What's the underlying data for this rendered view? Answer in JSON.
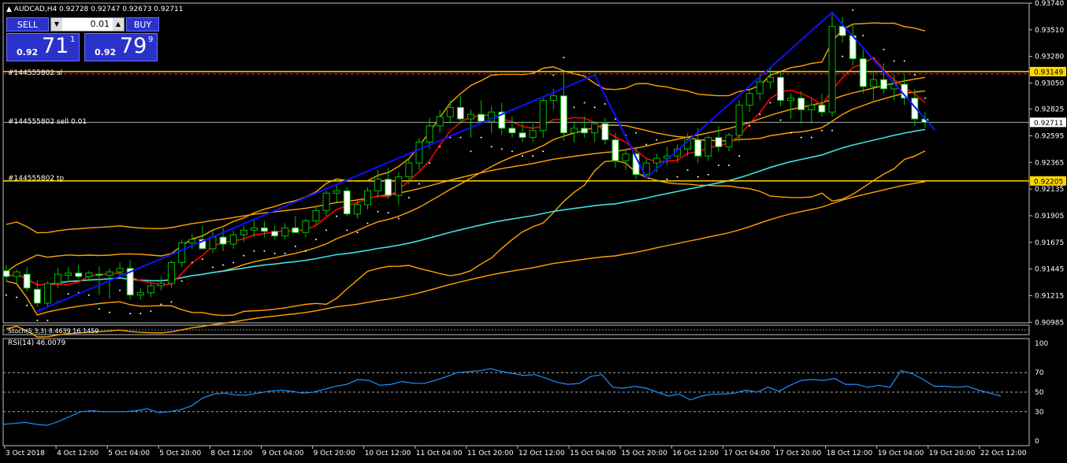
{
  "header": {
    "symbol_line": "AUDCAD,H4  0.92728 0.92747 0.92673 0.92711"
  },
  "one_click": {
    "sell_label": "SELL",
    "buy_label": "BUY",
    "lot": "0.01",
    "sell_small": "0.92",
    "sell_big": "71",
    "sell_sup": "1",
    "buy_small": "0.92",
    "buy_big": "79",
    "buy_sup": "9"
  },
  "order_lines": {
    "sl_label": "#144555802 sl",
    "sell_label": "#144555802 sell 0.01",
    "tp_label": "#144555802 tp"
  },
  "stoch_label": "Stoch(5,3,3) 8.4639 16.1459",
  "rsi_label": "RSI(14) 46.0079",
  "colors": {
    "bg": "#000000",
    "bull": "#00c000",
    "bear_body": "#ffffff",
    "ma_red": "#ff0000",
    "ma_cyan": "#40e0e0",
    "bands": "#ffa500",
    "zigzag": "#1010ff",
    "order_line": "#ffd700",
    "rsi_line": "#1e90ff"
  },
  "chart_data": {
    "type": "candlestick",
    "ylim": [
      0.9098,
      0.9374
    ],
    "y_ticks": [
      "0.93740",
      "0.93510",
      "0.93280",
      "0.93050",
      "0.92825",
      "0.92595",
      "0.92365",
      "0.92135",
      "0.91905",
      "0.91675",
      "0.91445",
      "0.91215",
      "0.90985"
    ],
    "x_ticks": [
      "3 Oct 2018",
      "4 Oct 12:00",
      "5 Oct 04:00",
      "5 Oct 20:00",
      "8 Oct 12:00",
      "9 Oct 04:00",
      "9 Oct 20:00",
      "10 Oct 12:00",
      "11 Oct 04:00",
      "11 Oct 20:00",
      "12 Oct 12:00",
      "15 Oct 04:00",
      "15 Oct 20:00",
      "16 Oct 12:00",
      "17 Oct 04:00",
      "17 Oct 20:00",
      "18 Oct 12:00",
      "19 Oct 04:00",
      "19 Oct 20:00",
      "22 Oct 12:00"
    ],
    "price_labels": {
      "sl": "0.93149",
      "current": "0.92711",
      "tp": "0.92205"
    },
    "levels": {
      "sl": 0.93149,
      "current": 0.92711,
      "tp": 0.92205
    },
    "candles": [
      {
        "o": 0.9143,
        "h": 0.9148,
        "l": 0.9134,
        "c": 0.9138
      },
      {
        "o": 0.9138,
        "h": 0.9144,
        "l": 0.9132,
        "c": 0.9142
      },
      {
        "o": 0.914,
        "h": 0.9146,
        "l": 0.9125,
        "c": 0.9128
      },
      {
        "o": 0.9127,
        "h": 0.9135,
        "l": 0.9112,
        "c": 0.9115
      },
      {
        "o": 0.9115,
        "h": 0.9134,
        "l": 0.9112,
        "c": 0.9132
      },
      {
        "o": 0.9132,
        "h": 0.9145,
        "l": 0.9128,
        "c": 0.914
      },
      {
        "o": 0.9139,
        "h": 0.9146,
        "l": 0.9135,
        "c": 0.9141
      },
      {
        "o": 0.9141,
        "h": 0.9148,
        "l": 0.9136,
        "c": 0.9138
      },
      {
        "o": 0.9138,
        "h": 0.9143,
        "l": 0.9134,
        "c": 0.9141
      },
      {
        "o": 0.914,
        "h": 0.9147,
        "l": 0.9122,
        "c": 0.9139
      },
      {
        "o": 0.9139,
        "h": 0.9145,
        "l": 0.9119,
        "c": 0.9142
      },
      {
        "o": 0.9142,
        "h": 0.915,
        "l": 0.9138,
        "c": 0.9145
      },
      {
        "o": 0.9145,
        "h": 0.9152,
        "l": 0.9118,
        "c": 0.9122
      },
      {
        "o": 0.9122,
        "h": 0.9128,
        "l": 0.9118,
        "c": 0.9124
      },
      {
        "o": 0.9124,
        "h": 0.9132,
        "l": 0.912,
        "c": 0.913
      },
      {
        "o": 0.913,
        "h": 0.9138,
        "l": 0.9126,
        "c": 0.9132
      },
      {
        "o": 0.9132,
        "h": 0.9152,
        "l": 0.9128,
        "c": 0.915
      },
      {
        "o": 0.915,
        "h": 0.917,
        "l": 0.9146,
        "c": 0.9167
      },
      {
        "o": 0.9167,
        "h": 0.9175,
        "l": 0.9162,
        "c": 0.917
      },
      {
        "o": 0.917,
        "h": 0.9182,
        "l": 0.9165,
        "c": 0.9162
      },
      {
        "o": 0.9162,
        "h": 0.9178,
        "l": 0.9158,
        "c": 0.9172
      },
      {
        "o": 0.9172,
        "h": 0.918,
        "l": 0.916,
        "c": 0.9166
      },
      {
        "o": 0.9166,
        "h": 0.9178,
        "l": 0.9162,
        "c": 0.9174
      },
      {
        "o": 0.9174,
        "h": 0.9182,
        "l": 0.9168,
        "c": 0.9178
      },
      {
        "o": 0.9178,
        "h": 0.9188,
        "l": 0.9172,
        "c": 0.918
      },
      {
        "o": 0.918,
        "h": 0.9186,
        "l": 0.9172,
        "c": 0.9177
      },
      {
        "o": 0.9177,
        "h": 0.9182,
        "l": 0.917,
        "c": 0.9173
      },
      {
        "o": 0.9173,
        "h": 0.9184,
        "l": 0.917,
        "c": 0.918
      },
      {
        "o": 0.918,
        "h": 0.919,
        "l": 0.9176,
        "c": 0.9176
      },
      {
        "o": 0.9176,
        "h": 0.9188,
        "l": 0.9172,
        "c": 0.9186
      },
      {
        "o": 0.9186,
        "h": 0.9198,
        "l": 0.9182,
        "c": 0.9195
      },
      {
        "o": 0.9195,
        "h": 0.9212,
        "l": 0.919,
        "c": 0.921
      },
      {
        "o": 0.921,
        "h": 0.9218,
        "l": 0.9202,
        "c": 0.9212
      },
      {
        "o": 0.9212,
        "h": 0.9215,
        "l": 0.919,
        "c": 0.9192
      },
      {
        "o": 0.9192,
        "h": 0.9205,
        "l": 0.9188,
        "c": 0.92
      },
      {
        "o": 0.92,
        "h": 0.9215,
        "l": 0.9196,
        "c": 0.9212
      },
      {
        "o": 0.9212,
        "h": 0.923,
        "l": 0.9206,
        "c": 0.9222
      },
      {
        "o": 0.9222,
        "h": 0.9232,
        "l": 0.9205,
        "c": 0.9208
      },
      {
        "o": 0.9208,
        "h": 0.9228,
        "l": 0.92,
        "c": 0.9224
      },
      {
        "o": 0.9224,
        "h": 0.924,
        "l": 0.9218,
        "c": 0.9236
      },
      {
        "o": 0.9236,
        "h": 0.9258,
        "l": 0.923,
        "c": 0.9254
      },
      {
        "o": 0.9254,
        "h": 0.9275,
        "l": 0.9248,
        "c": 0.9268
      },
      {
        "o": 0.9268,
        "h": 0.9282,
        "l": 0.9262,
        "c": 0.9276
      },
      {
        "o": 0.9276,
        "h": 0.929,
        "l": 0.927,
        "c": 0.9284
      },
      {
        "o": 0.9284,
        "h": 0.9294,
        "l": 0.927,
        "c": 0.9274
      },
      {
        "o": 0.9274,
        "h": 0.9282,
        "l": 0.9258,
        "c": 0.9278
      },
      {
        "o": 0.9278,
        "h": 0.929,
        "l": 0.927,
        "c": 0.9272
      },
      {
        "o": 0.9272,
        "h": 0.9285,
        "l": 0.9262,
        "c": 0.928
      },
      {
        "o": 0.928,
        "h": 0.9288,
        "l": 0.926,
        "c": 0.9266
      },
      {
        "o": 0.9266,
        "h": 0.9276,
        "l": 0.9258,
        "c": 0.9262
      },
      {
        "o": 0.9262,
        "h": 0.9272,
        "l": 0.9254,
        "c": 0.9258
      },
      {
        "o": 0.9258,
        "h": 0.927,
        "l": 0.9254,
        "c": 0.9264
      },
      {
        "o": 0.9264,
        "h": 0.9292,
        "l": 0.9258,
        "c": 0.929
      },
      {
        "o": 0.929,
        "h": 0.93,
        "l": 0.9282,
        "c": 0.9294
      },
      {
        "o": 0.9294,
        "h": 0.9315,
        "l": 0.9255,
        "c": 0.9262
      },
      {
        "o": 0.9262,
        "h": 0.9272,
        "l": 0.9254,
        "c": 0.9266
      },
      {
        "o": 0.9266,
        "h": 0.9276,
        "l": 0.9258,
        "c": 0.9262
      },
      {
        "o": 0.9262,
        "h": 0.9272,
        "l": 0.9254,
        "c": 0.927
      },
      {
        "o": 0.927,
        "h": 0.9275,
        "l": 0.9252,
        "c": 0.9256
      },
      {
        "o": 0.9256,
        "h": 0.9262,
        "l": 0.9232,
        "c": 0.9238
      },
      {
        "o": 0.9238,
        "h": 0.9248,
        "l": 0.923,
        "c": 0.9244
      },
      {
        "o": 0.9244,
        "h": 0.925,
        "l": 0.9222,
        "c": 0.9226
      },
      {
        "o": 0.9226,
        "h": 0.924,
        "l": 0.9222,
        "c": 0.9236
      },
      {
        "o": 0.9236,
        "h": 0.9244,
        "l": 0.9228,
        "c": 0.924
      },
      {
        "o": 0.924,
        "h": 0.925,
        "l": 0.9234,
        "c": 0.9242
      },
      {
        "o": 0.9242,
        "h": 0.9252,
        "l": 0.9236,
        "c": 0.9248
      },
      {
        "o": 0.9248,
        "h": 0.9262,
        "l": 0.9242,
        "c": 0.9256
      },
      {
        "o": 0.9256,
        "h": 0.9266,
        "l": 0.9236,
        "c": 0.9242
      },
      {
        "o": 0.9242,
        "h": 0.926,
        "l": 0.9238,
        "c": 0.9258
      },
      {
        "o": 0.9258,
        "h": 0.9268,
        "l": 0.9246,
        "c": 0.925
      },
      {
        "o": 0.925,
        "h": 0.9262,
        "l": 0.9246,
        "c": 0.926
      },
      {
        "o": 0.926,
        "h": 0.929,
        "l": 0.9254,
        "c": 0.9286
      },
      {
        "o": 0.9286,
        "h": 0.93,
        "l": 0.928,
        "c": 0.9296
      },
      {
        "o": 0.9296,
        "h": 0.9312,
        "l": 0.929,
        "c": 0.9306
      },
      {
        "o": 0.9306,
        "h": 0.9318,
        "l": 0.93,
        "c": 0.931
      },
      {
        "o": 0.931,
        "h": 0.9314,
        "l": 0.9285,
        "c": 0.929
      },
      {
        "o": 0.929,
        "h": 0.9296,
        "l": 0.9274,
        "c": 0.9292
      },
      {
        "o": 0.9292,
        "h": 0.9298,
        "l": 0.927,
        "c": 0.9282
      },
      {
        "o": 0.9282,
        "h": 0.9292,
        "l": 0.927,
        "c": 0.9286
      },
      {
        "o": 0.9286,
        "h": 0.9296,
        "l": 0.9276,
        "c": 0.928
      },
      {
        "o": 0.928,
        "h": 0.9366,
        "l": 0.9276,
        "c": 0.9354
      },
      {
        "o": 0.9354,
        "h": 0.9362,
        "l": 0.934,
        "c": 0.9346
      },
      {
        "o": 0.9346,
        "h": 0.9356,
        "l": 0.932,
        "c": 0.9326
      },
      {
        "o": 0.9326,
        "h": 0.9334,
        "l": 0.9296,
        "c": 0.9302
      },
      {
        "o": 0.9302,
        "h": 0.9314,
        "l": 0.929,
        "c": 0.9308
      },
      {
        "o": 0.9308,
        "h": 0.9322,
        "l": 0.9296,
        "c": 0.93
      },
      {
        "o": 0.93,
        "h": 0.9312,
        "l": 0.929,
        "c": 0.9304
      },
      {
        "o": 0.9304,
        "h": 0.9312,
        "l": 0.9286,
        "c": 0.9292
      },
      {
        "o": 0.9292,
        "h": 0.93,
        "l": 0.9268,
        "c": 0.9274
      },
      {
        "o": 0.9274,
        "h": 0.928,
        "l": 0.9266,
        "c": 0.9271
      }
    ],
    "rsi": {
      "ylim": [
        0,
        100
      ],
      "ticks": [
        100,
        70,
        50,
        30,
        0
      ],
      "levels": [
        70,
        50,
        30
      ],
      "values": [
        17,
        18,
        19,
        17,
        16,
        20,
        25,
        30,
        31,
        30,
        30,
        30,
        31,
        33,
        29,
        30,
        32,
        36,
        44,
        48,
        49,
        47,
        47,
        49,
        51,
        52,
        51,
        49,
        50,
        53,
        56,
        58,
        63,
        62,
        57,
        58,
        61,
        59,
        59,
        62,
        66,
        70,
        71,
        72,
        74,
        71,
        69,
        67,
        68,
        64,
        60,
        58,
        59,
        66,
        68,
        55,
        54,
        56,
        54,
        50,
        46,
        48,
        42,
        46,
        48,
        48,
        49,
        52,
        50,
        55,
        51,
        57,
        62,
        63,
        62,
        64,
        58,
        58,
        55,
        57,
        55,
        72,
        69,
        63,
        56,
        56,
        55,
        56,
        52,
        49,
        46
      ]
    }
  }
}
